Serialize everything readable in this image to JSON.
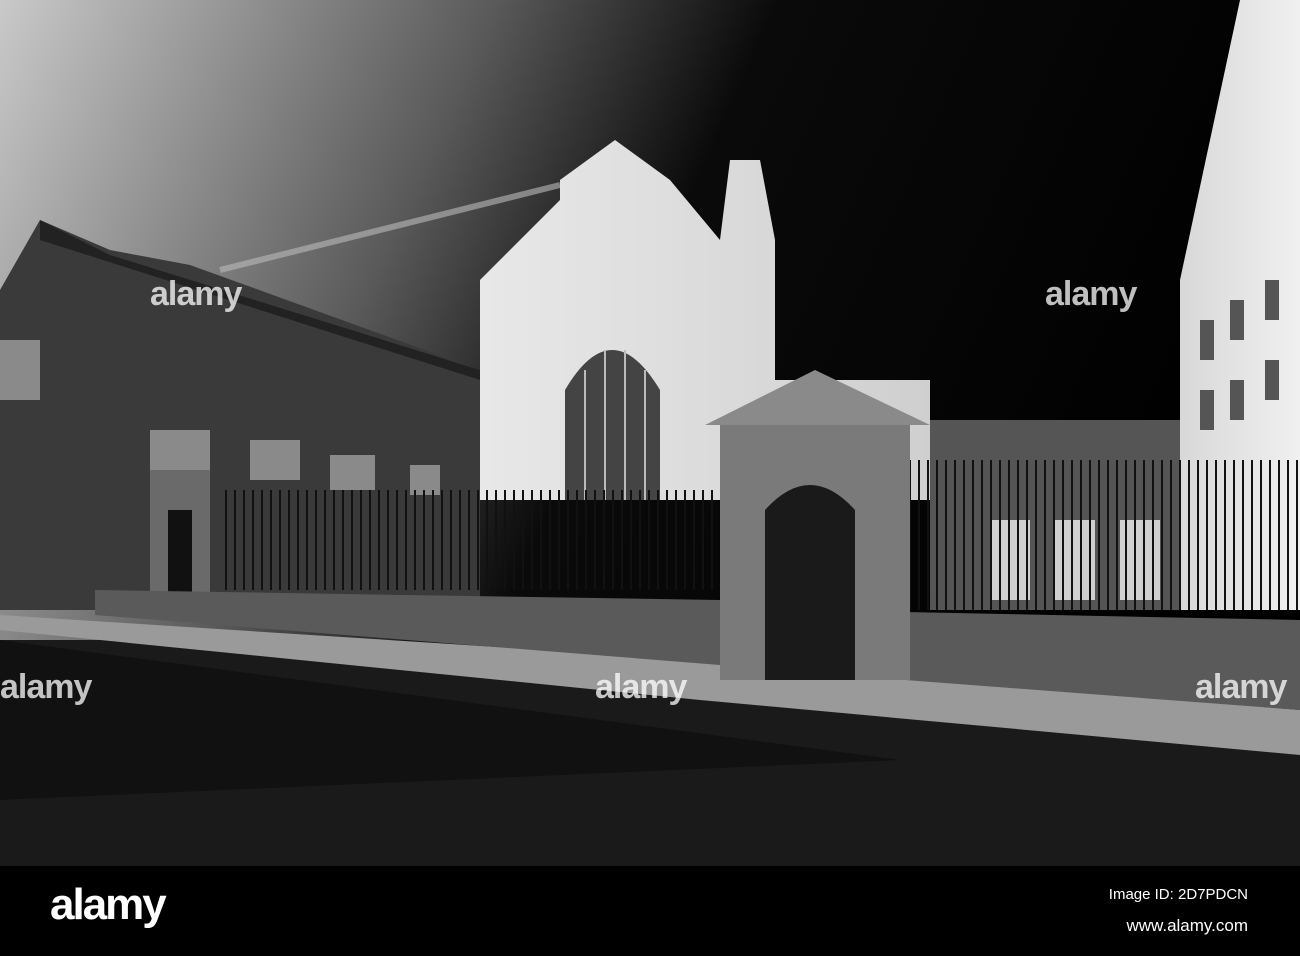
{
  "watermark": {
    "text": "alamy"
  },
  "banner": {
    "logo": "alamy",
    "image_id": "Image ID: 2D7PDCN",
    "url": "www.alamy.com"
  }
}
